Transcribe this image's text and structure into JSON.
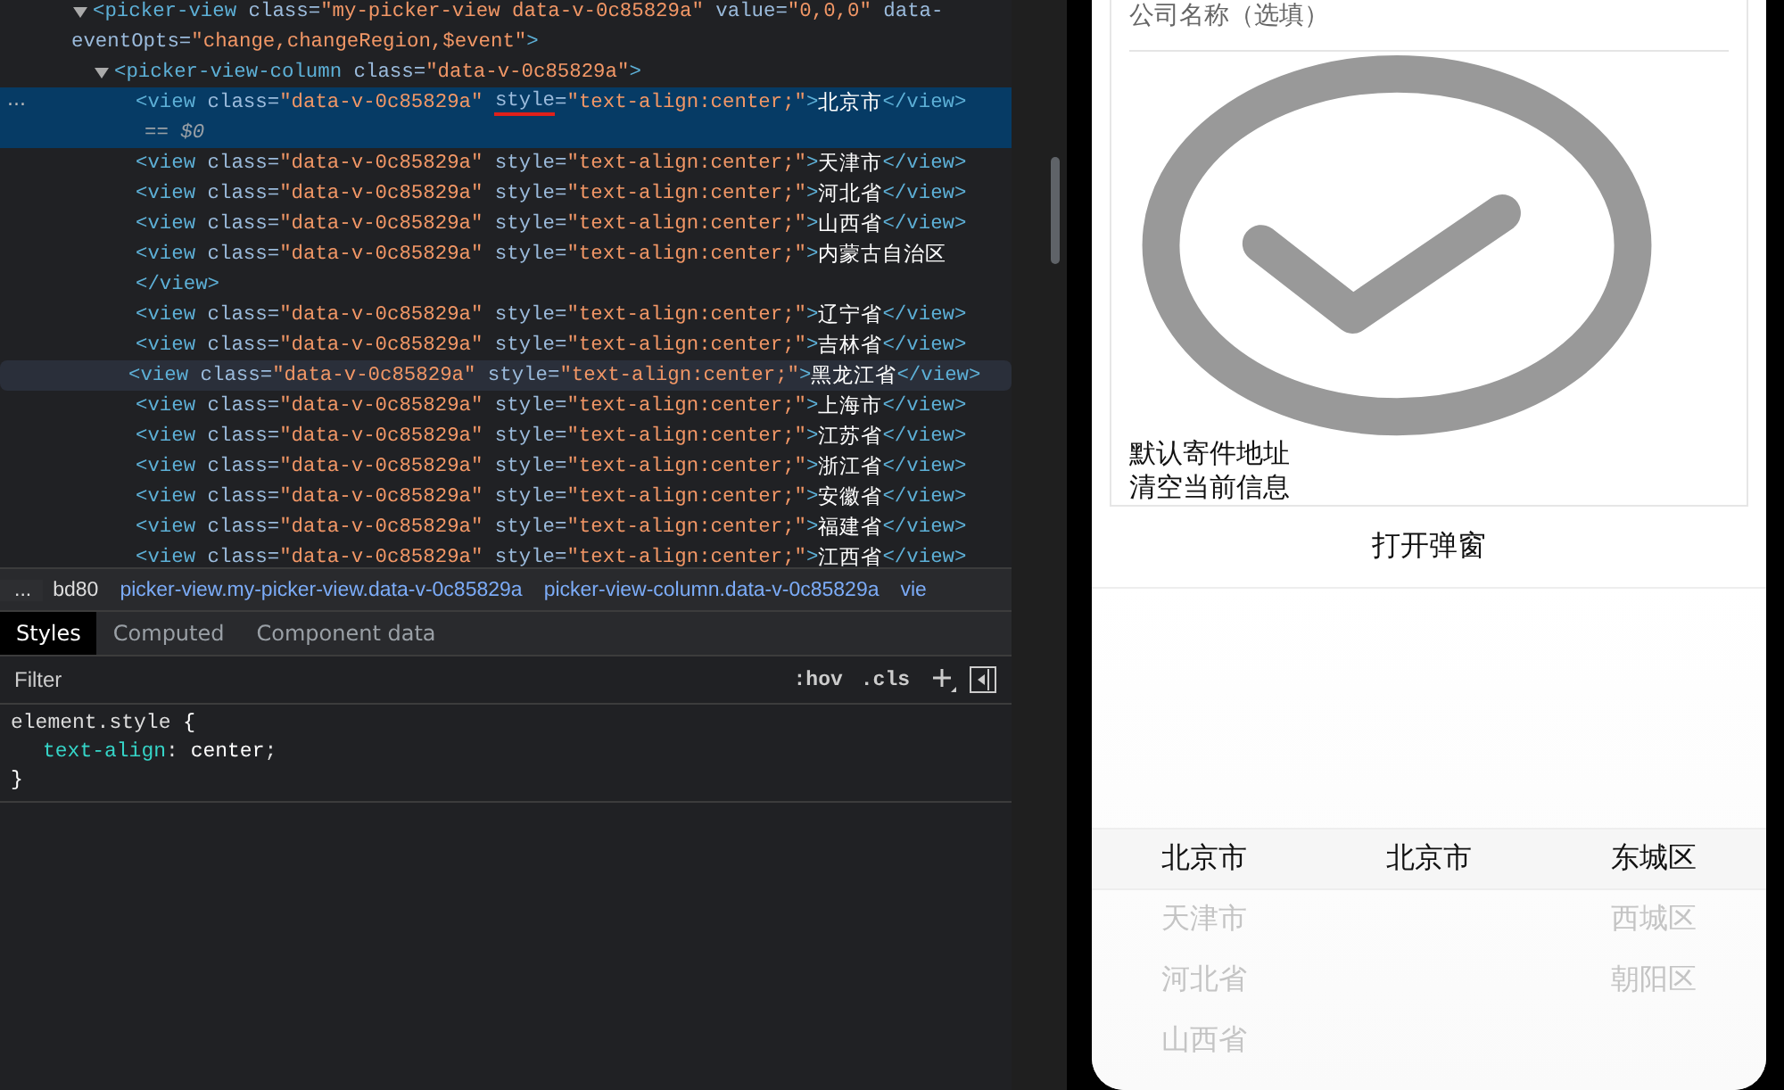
{
  "devtools": {
    "elements": {
      "more_button": "...",
      "tree": {
        "expanded": true,
        "selected": false,
        "hovered": false,
        "lines": [
          [
            {
              "kind": "tag",
              "text": "<picker-view"
            },
            {
              "kind": "attr",
              "text": " class="
            },
            {
              "kind": "value",
              "text": "\"my-picker-view data-v-0c85829a\""
            },
            {
              "kind": "attr",
              "text": " value="
            },
            {
              "kind": "value",
              "text": "\"0,0,0\""
            },
            {
              "kind": "attr",
              "text": " data-"
            }
          ],
          [
            {
              "kind": "attr",
              "text": "eventOpts="
            },
            {
              "kind": "value",
              "text": "\"change,changeRegion,$event\""
            },
            {
              "kind": "tag",
              "text": ">"
            }
          ]
        ],
        "children": [
          {
            "expanded": true,
            "selected": false,
            "hovered": false,
            "lines": [
              [
                {
                  "kind": "tag",
                  "text": "<picker-view-column"
                },
                {
                  "kind": "attr",
                  "text": " class="
                },
                {
                  "kind": "value",
                  "text": "\"data-v-0c85829a\""
                },
                {
                  "kind": "tag",
                  "text": ">"
                }
              ]
            ],
            "children": [
              {
                "selected": true,
                "hovered": false,
                "lines": [
                  [
                    {
                      "kind": "tag",
                      "text": "<view"
                    },
                    {
                      "kind": "attr",
                      "text": " class="
                    },
                    {
                      "kind": "value",
                      "text": "\"data-v-0c85829a\" "
                    },
                    {
                      "kind": "attr",
                      "text": "style",
                      "annotated": true
                    },
                    {
                      "kind": "attr",
                      "text": "="
                    },
                    {
                      "kind": "value",
                      "text": "\"text-align:center;\""
                    },
                    {
                      "kind": "tag",
                      "text": ">"
                    },
                    {
                      "kind": "text",
                      "text": "北京市"
                    },
                    {
                      "kind": "tag",
                      "text": "</view>"
                    }
                  ],
                  [
                    {
                      "kind": "marker",
                      "text": "== $0"
                    }
                  ]
                ]
              },
              {
                "selected": false,
                "hovered": false,
                "lines": [
                  [
                    {
                      "kind": "tag",
                      "text": "<view"
                    },
                    {
                      "kind": "attr",
                      "text": " class="
                    },
                    {
                      "kind": "value",
                      "text": "\"data-v-0c85829a\""
                    },
                    {
                      "kind": "attr",
                      "text": " style="
                    },
                    {
                      "kind": "value",
                      "text": "\"text-align:center;\""
                    },
                    {
                      "kind": "tag",
                      "text": ">"
                    },
                    {
                      "kind": "text",
                      "text": "天津市"
                    },
                    {
                      "kind": "tag",
                      "text": "</view>"
                    }
                  ]
                ]
              },
              {
                "selected": false,
                "hovered": false,
                "lines": [
                  [
                    {
                      "kind": "tag",
                      "text": "<view"
                    },
                    {
                      "kind": "attr",
                      "text": " class="
                    },
                    {
                      "kind": "value",
                      "text": "\"data-v-0c85829a\""
                    },
                    {
                      "kind": "attr",
                      "text": " style="
                    },
                    {
                      "kind": "value",
                      "text": "\"text-align:center;\""
                    },
                    {
                      "kind": "tag",
                      "text": ">"
                    },
                    {
                      "kind": "text",
                      "text": "河北省"
                    },
                    {
                      "kind": "tag",
                      "text": "</view>"
                    }
                  ]
                ]
              },
              {
                "selected": false,
                "hovered": false,
                "lines": [
                  [
                    {
                      "kind": "tag",
                      "text": "<view"
                    },
                    {
                      "kind": "attr",
                      "text": " class="
                    },
                    {
                      "kind": "value",
                      "text": "\"data-v-0c85829a\""
                    },
                    {
                      "kind": "attr",
                      "text": " style="
                    },
                    {
                      "kind": "value",
                      "text": "\"text-align:center;\""
                    },
                    {
                      "kind": "tag",
                      "text": ">"
                    },
                    {
                      "kind": "text",
                      "text": "山西省"
                    },
                    {
                      "kind": "tag",
                      "text": "</view>"
                    }
                  ]
                ]
              },
              {
                "selected": false,
                "hovered": false,
                "lines": [
                  [
                    {
                      "kind": "tag",
                      "text": "<view"
                    },
                    {
                      "kind": "attr",
                      "text": " class="
                    },
                    {
                      "kind": "value",
                      "text": "\"data-v-0c85829a\""
                    },
                    {
                      "kind": "attr",
                      "text": " style="
                    },
                    {
                      "kind": "value",
                      "text": "\"text-align:center;\""
                    },
                    {
                      "kind": "tag",
                      "text": ">"
                    },
                    {
                      "kind": "text",
                      "text": "内蒙古自治区"
                    }
                  ],
                  [
                    {
                      "kind": "tag",
                      "text": "</view>"
                    }
                  ]
                ]
              },
              {
                "selected": false,
                "hovered": false,
                "lines": [
                  [
                    {
                      "kind": "tag",
                      "text": "<view"
                    },
                    {
                      "kind": "attr",
                      "text": " class="
                    },
                    {
                      "kind": "value",
                      "text": "\"data-v-0c85829a\""
                    },
                    {
                      "kind": "attr",
                      "text": " style="
                    },
                    {
                      "kind": "value",
                      "text": "\"text-align:center;\""
                    },
                    {
                      "kind": "tag",
                      "text": ">"
                    },
                    {
                      "kind": "text",
                      "text": "辽宁省"
                    },
                    {
                      "kind": "tag",
                      "text": "</view>"
                    }
                  ]
                ]
              },
              {
                "selected": false,
                "hovered": false,
                "lines": [
                  [
                    {
                      "kind": "tag",
                      "text": "<view"
                    },
                    {
                      "kind": "attr",
                      "text": " class="
                    },
                    {
                      "kind": "value",
                      "text": "\"data-v-0c85829a\""
                    },
                    {
                      "kind": "attr",
                      "text": " style="
                    },
                    {
                      "kind": "value",
                      "text": "\"text-align:center;\""
                    },
                    {
                      "kind": "tag",
                      "text": ">"
                    },
                    {
                      "kind": "text",
                      "text": "吉林省"
                    },
                    {
                      "kind": "tag",
                      "text": "</view>"
                    }
                  ]
                ]
              },
              {
                "selected": false,
                "hovered": true,
                "lines": [
                  [
                    {
                      "kind": "tag",
                      "text": "<view"
                    },
                    {
                      "kind": "attr",
                      "text": " class="
                    },
                    {
                      "kind": "value",
                      "text": "\"data-v-0c85829a\""
                    },
                    {
                      "kind": "attr",
                      "text": " style="
                    },
                    {
                      "kind": "value",
                      "text": "\"text-align:center;\""
                    },
                    {
                      "kind": "tag",
                      "text": ">"
                    },
                    {
                      "kind": "text",
                      "text": "黑龙江省"
                    },
                    {
                      "kind": "tag",
                      "text": "</view>"
                    }
                  ]
                ]
              },
              {
                "selected": false,
                "hovered": false,
                "lines": [
                  [
                    {
                      "kind": "tag",
                      "text": "<view"
                    },
                    {
                      "kind": "attr",
                      "text": " class="
                    },
                    {
                      "kind": "value",
                      "text": "\"data-v-0c85829a\""
                    },
                    {
                      "kind": "attr",
                      "text": " style="
                    },
                    {
                      "kind": "value",
                      "text": "\"text-align:center;\""
                    },
                    {
                      "kind": "tag",
                      "text": ">"
                    },
                    {
                      "kind": "text",
                      "text": "上海市"
                    },
                    {
                      "kind": "tag",
                      "text": "</view>"
                    }
                  ]
                ]
              },
              {
                "selected": false,
                "hovered": false,
                "lines": [
                  [
                    {
                      "kind": "tag",
                      "text": "<view"
                    },
                    {
                      "kind": "attr",
                      "text": " class="
                    },
                    {
                      "kind": "value",
                      "text": "\"data-v-0c85829a\""
                    },
                    {
                      "kind": "attr",
                      "text": " style="
                    },
                    {
                      "kind": "value",
                      "text": "\"text-align:center;\""
                    },
                    {
                      "kind": "tag",
                      "text": ">"
                    },
                    {
                      "kind": "text",
                      "text": "江苏省"
                    },
                    {
                      "kind": "tag",
                      "text": "</view>"
                    }
                  ]
                ]
              },
              {
                "selected": false,
                "hovered": false,
                "lines": [
                  [
                    {
                      "kind": "tag",
                      "text": "<view"
                    },
                    {
                      "kind": "attr",
                      "text": " class="
                    },
                    {
                      "kind": "value",
                      "text": "\"data-v-0c85829a\""
                    },
                    {
                      "kind": "attr",
                      "text": " style="
                    },
                    {
                      "kind": "value",
                      "text": "\"text-align:center;\""
                    },
                    {
                      "kind": "tag",
                      "text": ">"
                    },
                    {
                      "kind": "text",
                      "text": "浙江省"
                    },
                    {
                      "kind": "tag",
                      "text": "</view>"
                    }
                  ]
                ]
              },
              {
                "selected": false,
                "hovered": false,
                "lines": [
                  [
                    {
                      "kind": "tag",
                      "text": "<view"
                    },
                    {
                      "kind": "attr",
                      "text": " class="
                    },
                    {
                      "kind": "value",
                      "text": "\"data-v-0c85829a\""
                    },
                    {
                      "kind": "attr",
                      "text": " style="
                    },
                    {
                      "kind": "value",
                      "text": "\"text-align:center;\""
                    },
                    {
                      "kind": "tag",
                      "text": ">"
                    },
                    {
                      "kind": "text",
                      "text": "安徽省"
                    },
                    {
                      "kind": "tag",
                      "text": "</view>"
                    }
                  ]
                ]
              },
              {
                "selected": false,
                "hovered": false,
                "lines": [
                  [
                    {
                      "kind": "tag",
                      "text": "<view"
                    },
                    {
                      "kind": "attr",
                      "text": " class="
                    },
                    {
                      "kind": "value",
                      "text": "\"data-v-0c85829a\""
                    },
                    {
                      "kind": "attr",
                      "text": " style="
                    },
                    {
                      "kind": "value",
                      "text": "\"text-align:center;\""
                    },
                    {
                      "kind": "tag",
                      "text": ">"
                    },
                    {
                      "kind": "text",
                      "text": "福建省"
                    },
                    {
                      "kind": "tag",
                      "text": "</view>"
                    }
                  ]
                ]
              },
              {
                "selected": false,
                "hovered": false,
                "lines": [
                  [
                    {
                      "kind": "tag",
                      "text": "<view"
                    },
                    {
                      "kind": "attr",
                      "text": " class="
                    },
                    {
                      "kind": "value",
                      "text": "\"data-v-0c85829a\""
                    },
                    {
                      "kind": "attr",
                      "text": " style="
                    },
                    {
                      "kind": "value",
                      "text": "\"text-align:center;\""
                    },
                    {
                      "kind": "tag",
                      "text": ">"
                    },
                    {
                      "kind": "text",
                      "text": "江西省"
                    },
                    {
                      "kind": "tag",
                      "text": "</view>"
                    }
                  ]
                ]
              }
            ]
          }
        ]
      }
    },
    "breadcrumbs": {
      "more": "...",
      "items": [
        "bd80",
        "picker-view.my-picker-view.data-v-0c85829a",
        "picker-view-column.data-v-0c85829a",
        "vie"
      ]
    },
    "tabs": [
      {
        "label": "Styles",
        "selected": true
      },
      {
        "label": "Computed",
        "selected": false
      },
      {
        "label": "Component data",
        "selected": false
      }
    ],
    "filter": {
      "placeholder": "Filter",
      "buttons": [
        ":hov",
        ".cls"
      ]
    },
    "rule": {
      "selector": "element.style",
      "open": " {",
      "declarations": [
        {
          "property": "text-align",
          "separator": ": ",
          "value": "center",
          "end": ";"
        }
      ],
      "close": "}"
    }
  },
  "phone": {
    "company_field": {
      "placeholder": "公司名称（选填）"
    },
    "links": [
      "默认寄件地址",
      "清空当前信息"
    ],
    "open_button": "打开弹窗",
    "picker": {
      "columns": [
        {
          "items": [
            {
              "label": "北京市",
              "selected": true
            },
            {
              "label": "天津市",
              "selected": false
            },
            {
              "label": "河北省",
              "selected": false
            },
            {
              "label": "山西省",
              "selected": false
            }
          ]
        },
        {
          "items": [
            {
              "label": "北京市",
              "selected": true
            }
          ]
        },
        {
          "items": [
            {
              "label": "东城区",
              "selected": true
            },
            {
              "label": "西城区",
              "selected": false
            },
            {
              "label": "朝阳区",
              "selected": false
            }
          ]
        }
      ]
    }
  }
}
